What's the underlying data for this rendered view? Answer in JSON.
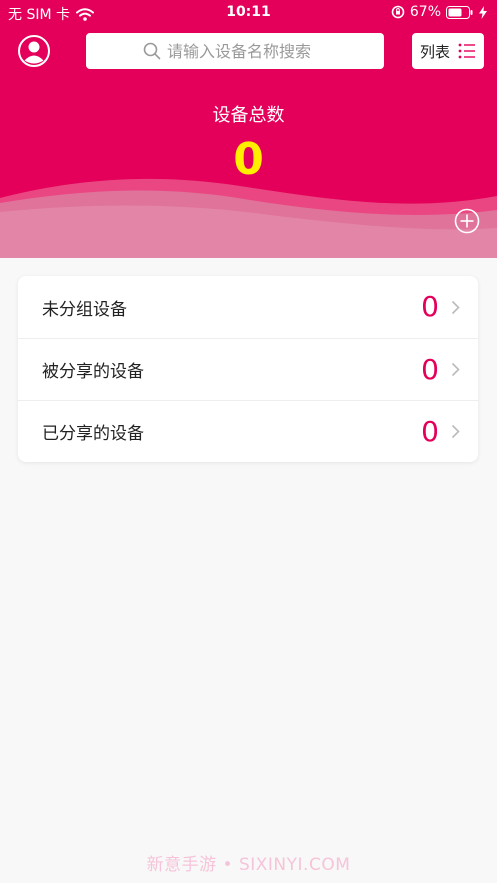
{
  "status_bar": {
    "carrier": "无 SIM 卡",
    "time": "10:11",
    "battery": "67%"
  },
  "header": {
    "avatar_icon": "user-avatar-icon",
    "search_placeholder": "请输入设备名称搜索",
    "list_label": "列表",
    "total_label": "设备总数",
    "total_count": "0"
  },
  "devices": {
    "rows": [
      {
        "label": "未分组设备",
        "count": "0"
      },
      {
        "label": "被分享的设备",
        "count": "0"
      },
      {
        "label": "已分享的设备",
        "count": "0"
      }
    ]
  },
  "watermark": "新意手游 • SIXINYI.COM",
  "colors": {
    "brand": "#e4005a",
    "count_highlight": "#ffee00",
    "background": "#f8f8f8"
  }
}
